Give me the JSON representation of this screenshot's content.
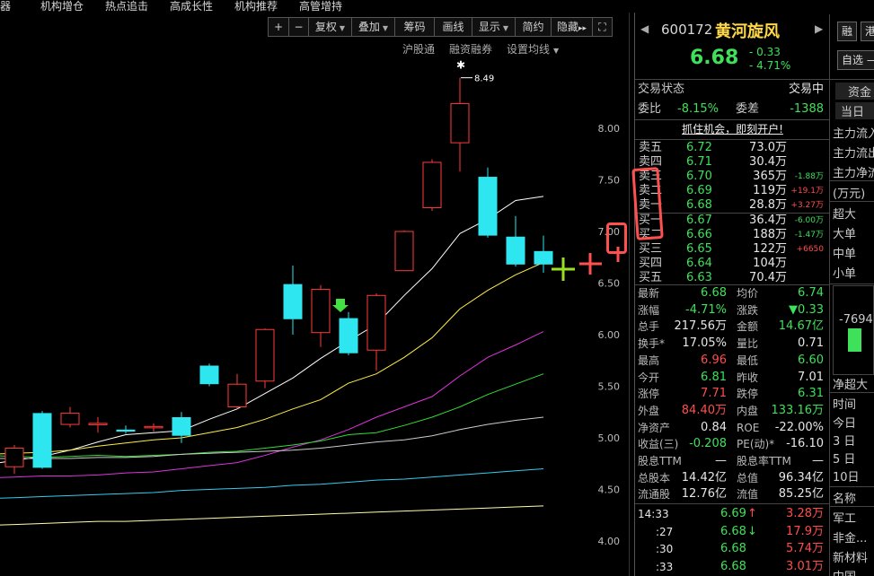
{
  "topnav": [
    "器",
    "机构增仓",
    "热点追击",
    "高成长性",
    "机构推荐",
    "高管增持"
  ],
  "toolbar": {
    "plus": "+",
    "minus": "−",
    "fuquan": "复权",
    "diejia": "叠加",
    "chouma": "筹码",
    "huaxian": "画线",
    "xianshi": "显示",
    "jianyue": "简约",
    "yincang": "隐藏",
    "yincang_arrows": "▸▸",
    "expand": "⛶"
  },
  "sublinks": {
    "hgt": "沪股通",
    "rzrq": "融资融券",
    "avg": "设置均线"
  },
  "chart": {
    "price_labels": [
      "8.00",
      "7.50",
      "7.00",
      "6.50",
      "6.00",
      "5.50",
      "5.00",
      "4.50",
      "4.00"
    ],
    "high_label": "8.49",
    "high_marker": "✱"
  },
  "chart_data": {
    "type": "candlestick",
    "ylim": [
      3.9,
      8.6
    ],
    "candles": [
      {
        "o": 4.72,
        "c": 4.9,
        "h": 4.93,
        "l": 4.65
      },
      {
        "o": 5.24,
        "c": 4.71,
        "h": 5.26,
        "l": 4.7
      },
      {
        "o": 5.13,
        "c": 5.24,
        "h": 5.3,
        "l": 5.1
      },
      {
        "o": 5.13,
        "c": 5.14,
        "h": 5.2,
        "l": 5.05
      },
      {
        "o": 5.08,
        "c": 5.06,
        "h": 5.12,
        "l": 5.04
      },
      {
        "o": 5.1,
        "c": 5.11,
        "h": 5.14,
        "l": 5.06
      },
      {
        "o": 5.2,
        "c": 5.02,
        "h": 5.25,
        "l": 4.95
      },
      {
        "o": 5.7,
        "c": 5.52,
        "h": 5.72,
        "l": 5.5
      },
      {
        "o": 5.3,
        "c": 5.52,
        "h": 5.62,
        "l": 5.28
      },
      {
        "o": 5.55,
        "c": 6.05,
        "h": 6.06,
        "l": 5.48
      },
      {
        "o": 6.49,
        "c": 6.15,
        "h": 6.67,
        "l": 6.0
      },
      {
        "o": 6.02,
        "c": 6.44,
        "h": 6.48,
        "l": 5.88
      },
      {
        "o": 6.16,
        "c": 5.82,
        "h": 6.22,
        "l": 5.8
      },
      {
        "o": 5.85,
        "c": 6.38,
        "h": 6.4,
        "l": 5.65
      },
      {
        "o": 6.62,
        "c": 7.0,
        "h": 7.01,
        "l": 6.62
      },
      {
        "o": 7.23,
        "c": 7.67,
        "h": 7.7,
        "l": 7.2
      },
      {
        "o": 7.86,
        "c": 8.24,
        "h": 8.49,
        "l": 7.58
      },
      {
        "o": 7.53,
        "c": 6.96,
        "h": 7.62,
        "l": 6.94
      },
      {
        "o": 6.95,
        "c": 6.68,
        "h": 7.15,
        "l": 6.66
      },
      {
        "o": 6.81,
        "c": 6.68,
        "h": 6.96,
        "l": 6.6
      }
    ],
    "ma": [
      {
        "color": "#ffffff",
        "values": [
          4.78,
          4.82,
          4.88,
          4.96,
          5.03,
          5.05,
          5.07,
          5.18,
          5.28,
          5.43,
          5.58,
          5.77,
          5.94,
          6.1,
          6.38,
          6.64,
          6.98,
          7.12,
          7.3,
          7.34
        ]
      },
      {
        "color": "#ffee44",
        "values": [
          4.85,
          4.86,
          4.88,
          4.92,
          4.95,
          4.98,
          5.0,
          5.05,
          5.1,
          5.18,
          5.28,
          5.37,
          5.53,
          5.62,
          5.78,
          5.97,
          6.25,
          6.43,
          6.58,
          6.7
        ]
      },
      {
        "color": "#dd33dd",
        "values": [
          4.62,
          4.63,
          4.63,
          4.64,
          4.66,
          4.67,
          4.7,
          4.73,
          4.76,
          4.83,
          4.91,
          4.98,
          5.08,
          5.2,
          5.3,
          5.4,
          5.6,
          5.78,
          5.9,
          6.03
        ]
      },
      {
        "color": "#33dd33",
        "values": [
          4.82,
          4.81,
          4.82,
          4.83,
          4.82,
          4.83,
          4.84,
          4.86,
          4.87,
          4.9,
          4.93,
          4.97,
          5.03,
          5.05,
          5.12,
          5.2,
          5.3,
          5.42,
          5.52,
          5.62
        ]
      },
      {
        "color": "#cccccc",
        "values": [
          4.8,
          4.8,
          4.8,
          4.81,
          4.81,
          4.82,
          4.84,
          4.85,
          4.86,
          4.87,
          4.88,
          4.9,
          4.93,
          4.96,
          4.98,
          5.02,
          5.08,
          5.13,
          5.17,
          5.2
        ]
      },
      {
        "color": "#33ccee",
        "values": [
          4.42,
          4.43,
          4.44,
          4.45,
          4.46,
          4.47,
          4.49,
          4.5,
          4.51,
          4.52,
          4.54,
          4.55,
          4.57,
          4.59,
          4.6,
          4.62,
          4.64,
          4.66,
          4.68,
          4.7
        ]
      },
      {
        "color": "#ffffaa",
        "values": [
          4.16,
          4.17,
          4.18,
          4.19,
          4.19,
          4.2,
          4.21,
          4.22,
          4.23,
          4.24,
          4.25,
          4.26,
          4.27,
          4.28,
          4.29,
          4.3,
          4.31,
          4.32,
          4.33,
          4.34
        ]
      }
    ]
  },
  "quote": {
    "code": "600172",
    "name": "黄河旋风",
    "price": "6.68",
    "change": "- 0.33",
    "change_pct": "- 4.71%",
    "status_label": "交易状态",
    "status_value": "交易中",
    "weibi_label": "委比",
    "weibi_value": "-8.15%",
    "weicha_label": "委差",
    "weicha_value": "-1388",
    "promo": "抓住机会，即刻开户!",
    "asks": [
      {
        "label": "卖五",
        "price": "6.72",
        "vol": "73.0万",
        "delta": ""
      },
      {
        "label": "卖四",
        "price": "6.71",
        "vol": "30.4万",
        "delta": ""
      },
      {
        "label": "卖三",
        "price": "6.70",
        "vol": "365万",
        "delta": "-1.88万"
      },
      {
        "label": "卖二",
        "price": "6.69",
        "vol": "119万",
        "delta": "+19.1万"
      },
      {
        "label": "卖一",
        "price": "6.68",
        "vol": "28.8万",
        "delta": "+3.27万"
      }
    ],
    "bids": [
      {
        "label": "买一",
        "price": "6.67",
        "vol": "36.4万",
        "delta": "-6.00万"
      },
      {
        "label": "买二",
        "price": "6.66",
        "vol": "188万",
        "delta": "-1.47万"
      },
      {
        "label": "买三",
        "price": "6.65",
        "vol": "122万",
        "delta": "+6650"
      },
      {
        "label": "买四",
        "price": "6.64",
        "vol": "104万",
        "delta": ""
      },
      {
        "label": "买五",
        "price": "6.63",
        "vol": "70.4万",
        "delta": ""
      }
    ],
    "stats": [
      [
        "最新",
        "6.68",
        "均价",
        "6.74"
      ],
      [
        "涨幅",
        "-4.71%",
        "涨跌",
        "▼0.33"
      ],
      [
        "总手",
        "217.56万",
        "金额",
        "14.67亿"
      ],
      [
        "换手*",
        "17.05%",
        "量比",
        "0.71"
      ],
      [
        "最高",
        "6.96",
        "最低",
        "6.60"
      ],
      [
        "今开",
        "6.81",
        "昨收",
        "7.01"
      ],
      [
        "涨停",
        "7.71",
        "跌停",
        "6.31"
      ],
      [
        "外盘",
        "84.40万",
        "内盘",
        "133.16万"
      ],
      [
        "净资产",
        "0.84",
        "ROE",
        "-22.00%"
      ],
      [
        "收益(三)",
        "-0.208",
        "PE(动)*",
        "-16.10"
      ],
      [
        "股息TTM",
        "—",
        "股息率TTM",
        "—"
      ],
      [
        "总股本",
        "14.42亿",
        "总值",
        "96.34亿"
      ],
      [
        "流通股",
        "12.76亿",
        "流值",
        "85.25亿"
      ]
    ],
    "ticks": [
      {
        "time": "14:33",
        "price": "6.69",
        "arrow": "↑",
        "vol": "3.28万"
      },
      {
        "time": ":27",
        "price": "6.68",
        "arrow": "↓",
        "vol": "17.9万"
      },
      {
        "time": ":30",
        "price": "6.68",
        "arrow": "",
        "vol": "5.74万"
      },
      {
        "time": ":33",
        "price": "6.68",
        "arrow": "",
        "vol": "3.01万"
      }
    ]
  },
  "rightcol": {
    "rong": "融",
    "gang": "港",
    "zixuan": "自选",
    "zijin": "资金",
    "dangri": "当日",
    "items": [
      "主力流入",
      "主力流出",
      "主力净流",
      "(万元)",
      "超大",
      "大单",
      "中单",
      "小单"
    ],
    "flow_value": "-7694",
    "jingchao": "净超大",
    "time_label": "时间",
    "periods": [
      "今日",
      "3 日",
      "5 日",
      "10日"
    ],
    "name_label": "名称",
    "sectors": [
      "军工",
      "非金...",
      "新材料",
      "中国..."
    ]
  }
}
